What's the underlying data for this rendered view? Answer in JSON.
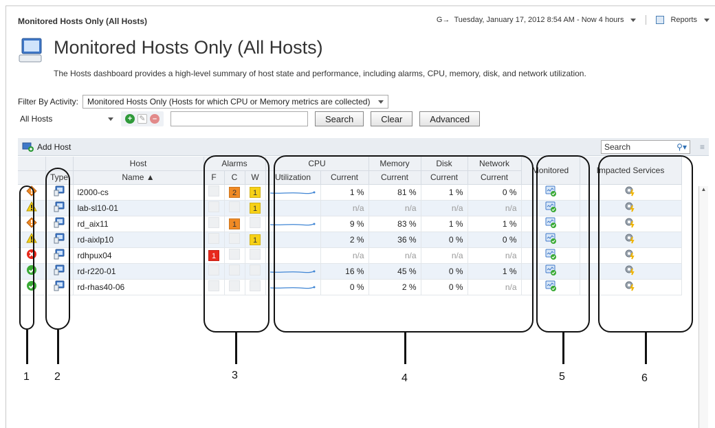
{
  "breadcrumb": "Monitored Hosts Only (All Hosts)",
  "time_range": "Tuesday, January 17, 2012 8:54 AM - Now 4 hours",
  "reports_label": "Reports",
  "page_title": "Monitored Hosts Only (All Hosts)",
  "description": "The Hosts dashboard provides a high-level summary of host state and performance, including alarms, CPU, memory, disk, and network utilization.",
  "filter": {
    "label": "Filter By Activity:",
    "value": "Monitored Hosts Only (Hosts for which CPU or Memory metrics are collected)"
  },
  "host_select": "All Hosts",
  "buttons": {
    "search": "Search",
    "clear": "Clear",
    "advanced": "Advanced"
  },
  "grid_toolbar": {
    "add_host": "Add Host",
    "search_placeholder": "Search"
  },
  "columns": {
    "host_group": "Host",
    "alarms_group": "Alarms",
    "cpu_group": "CPU",
    "memory_group": "Memory",
    "disk_group": "Disk",
    "network_group": "Network",
    "monitored": "Monitored",
    "impacted": "Impacted Services",
    "type": "Type",
    "name": "Name ▲",
    "f": "F",
    "c": "C",
    "w": "W",
    "utilization": "Utilization",
    "current": "Current"
  },
  "rows": [
    {
      "state": "critical",
      "name": "l2000-cs",
      "f": "",
      "c": "2",
      "w": "1",
      "spark": true,
      "cpu": "1 %",
      "mem": "81 %",
      "disk": "1 %",
      "net": "0 %"
    },
    {
      "state": "warning",
      "name": "lab-sl10-01",
      "f": "",
      "c": "",
      "w": "1",
      "spark": false,
      "cpu": "n/a",
      "mem": "n/a",
      "disk": "n/a",
      "net": "n/a"
    },
    {
      "state": "critical",
      "name": "rd_aix11",
      "f": "",
      "c": "1",
      "w": "",
      "spark": true,
      "cpu": "9 %",
      "mem": "83 %",
      "disk": "1 %",
      "net": "1 %"
    },
    {
      "state": "warning",
      "name": "rd-aixlp10",
      "f": "",
      "c": "",
      "w": "1",
      "spark": false,
      "cpu": "2 %",
      "mem": "36 %",
      "disk": "0 %",
      "net": "0 %"
    },
    {
      "state": "fatal",
      "name": "rdhpux04",
      "f": "1",
      "c": "",
      "w": "",
      "spark": false,
      "cpu": "n/a",
      "mem": "n/a",
      "disk": "n/a",
      "net": "n/a"
    },
    {
      "state": "normal",
      "name": "rd-r220-01",
      "f": "",
      "c": "",
      "w": "",
      "spark": true,
      "cpu": "16 %",
      "mem": "45 %",
      "disk": "0 %",
      "net": "1 %"
    },
    {
      "state": "normal",
      "name": "rd-rhas40-06",
      "f": "",
      "c": "",
      "w": "",
      "spark": true,
      "cpu": "0 %",
      "mem": "2 %",
      "disk": "0 %",
      "net": "n/a"
    }
  ],
  "callouts": [
    "1",
    "2",
    "3",
    "4",
    "5",
    "6"
  ],
  "colors": {
    "fatal": "#e8291c",
    "critical": "#f08a24",
    "warning": "#f7d117",
    "normal": "#3aaa35"
  }
}
